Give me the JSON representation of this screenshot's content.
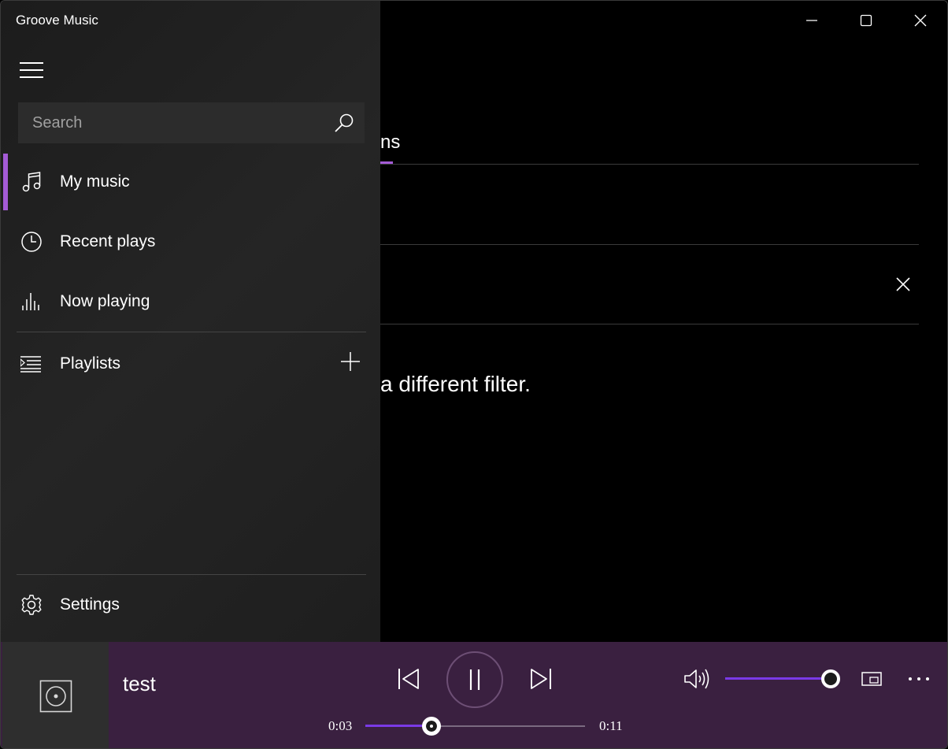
{
  "window": {
    "title": "Groove Music",
    "controls": [
      "minimize-icon",
      "maximize-icon",
      "close-icon"
    ]
  },
  "nav": {
    "search": {
      "placeholder": "Search",
      "icon": "search-icon"
    },
    "items": [
      {
        "label": "My music",
        "icon": "music-note-icon",
        "active": true
      },
      {
        "label": "Recent plays",
        "icon": "clock-icon",
        "active": false
      },
      {
        "label": "Now playing",
        "icon": "equalizer-icon",
        "active": false
      },
      {
        "label": "Playlists",
        "icon": "playlist-icon",
        "active": false
      }
    ],
    "add_playlist_icon": "plus-icon",
    "settings": {
      "label": "Settings",
      "icon": "gear-icon"
    }
  },
  "content": {
    "tab_fragment": "ns",
    "empty_message_fragment": "a different filter."
  },
  "player": {
    "track_title": "test",
    "current_time": "0:03",
    "total_time": "0:11",
    "progress_fraction": 0.3,
    "volume_fraction": 1.0,
    "state": "playing"
  },
  "colors": {
    "accent": "#a45bd6",
    "slider_fill": "#7a3ae6",
    "player_bg": "#3a2040",
    "nav_bg": "#1f1f1f",
    "content_bg": "#000000"
  }
}
